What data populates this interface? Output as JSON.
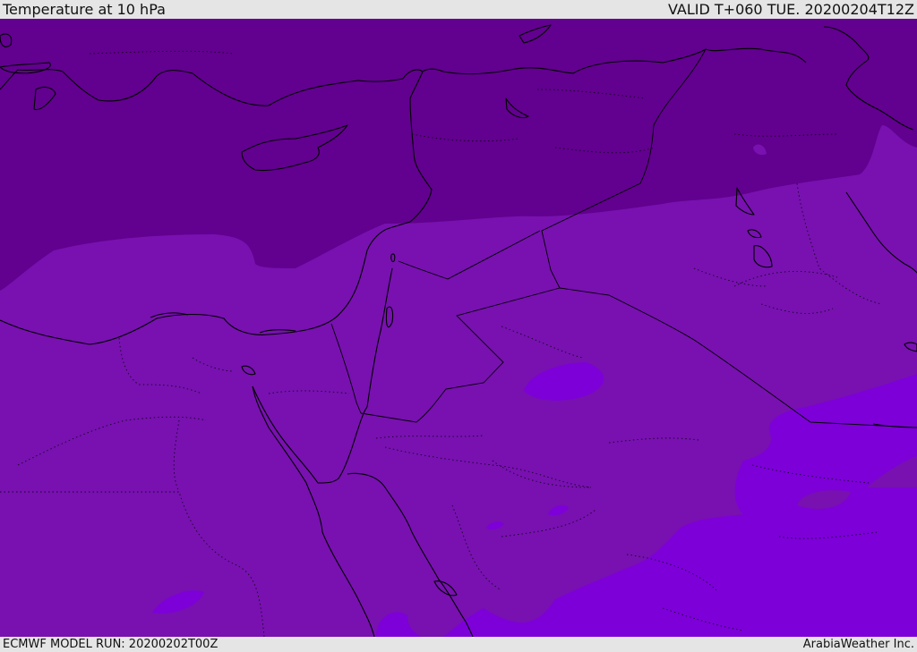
{
  "header": {
    "title": "Temperature at 10 hPa",
    "valid": "VALID T+060 TUE. 20200204T12Z"
  },
  "footer": {
    "model_run": "ECMWF MODEL RUN: 20200202T00Z",
    "credit": "ArabiaWeather Inc."
  },
  "map": {
    "colors": {
      "cold_band": "#62008f",
      "mid_band": "#7811b0",
      "warm_band": "#7d00d8",
      "coast": "#000000"
    }
  }
}
